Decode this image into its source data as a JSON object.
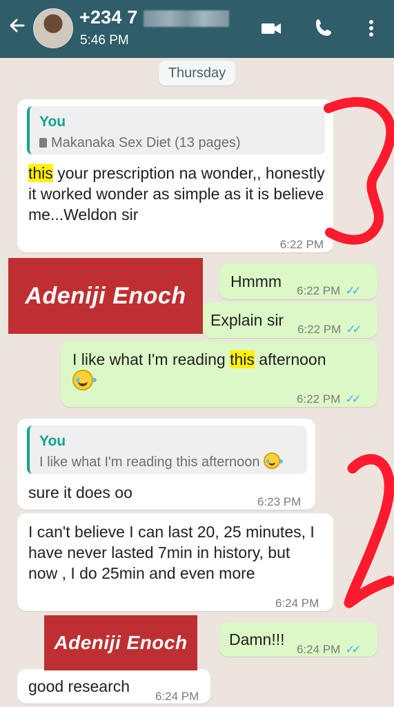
{
  "header": {
    "contact_name": "+234 7",
    "status": "5:46 PM",
    "icons": {
      "back": "arrow-left-icon",
      "video": "video-call-icon",
      "phone": "phone-icon",
      "menu": "more-vert-icon"
    }
  },
  "date_separator": "Thursday",
  "messages": {
    "m1": {
      "quote_title": "You",
      "quote_text": "Makanaka Sex Diet (13 pages)",
      "highlight": "this",
      "text_rest": "your prescription na wonder,, honestly it worked wonder as simple as it is  believe me...Weldon sir",
      "time": "6:22 PM"
    },
    "m2": {
      "text": "Hmmm",
      "time": "6:22 PM"
    },
    "m3": {
      "text": "Explain sir",
      "time": "6:22 PM"
    },
    "m4": {
      "pre": "I like what I'm reading ",
      "highlight": "this",
      "post": " afternoon",
      "time": "6:22 PM"
    },
    "m5": {
      "quote_title": "You",
      "quote_text": "I like what I'm reading this afternoon",
      "text": "sure it does oo",
      "time": "6:23 PM"
    },
    "m6": {
      "text": "I can't believe I can last 20, 25 minutes, I have never lasted 7min in history, but now , I do 25min and even more",
      "time": "6:24 PM"
    },
    "m7": {
      "text": "Damn!!!",
      "time": "6:24 PM"
    },
    "m8": {
      "text": "good research",
      "time": "6:24 PM"
    }
  },
  "watermarks": [
    "Adeniji Enoch",
    "Adeniji Enoch"
  ],
  "colors": {
    "header_bg": "#2f5d69",
    "chat_bg": "#ece5dd",
    "outgoing_bubble": "#dcf8c6",
    "incoming_bubble": "#ffffff",
    "accent": "#11a38b",
    "tick_blue": "#4aa6ff",
    "mark_red": "#ff1a2e",
    "watermark_red": "#bf2f32"
  }
}
